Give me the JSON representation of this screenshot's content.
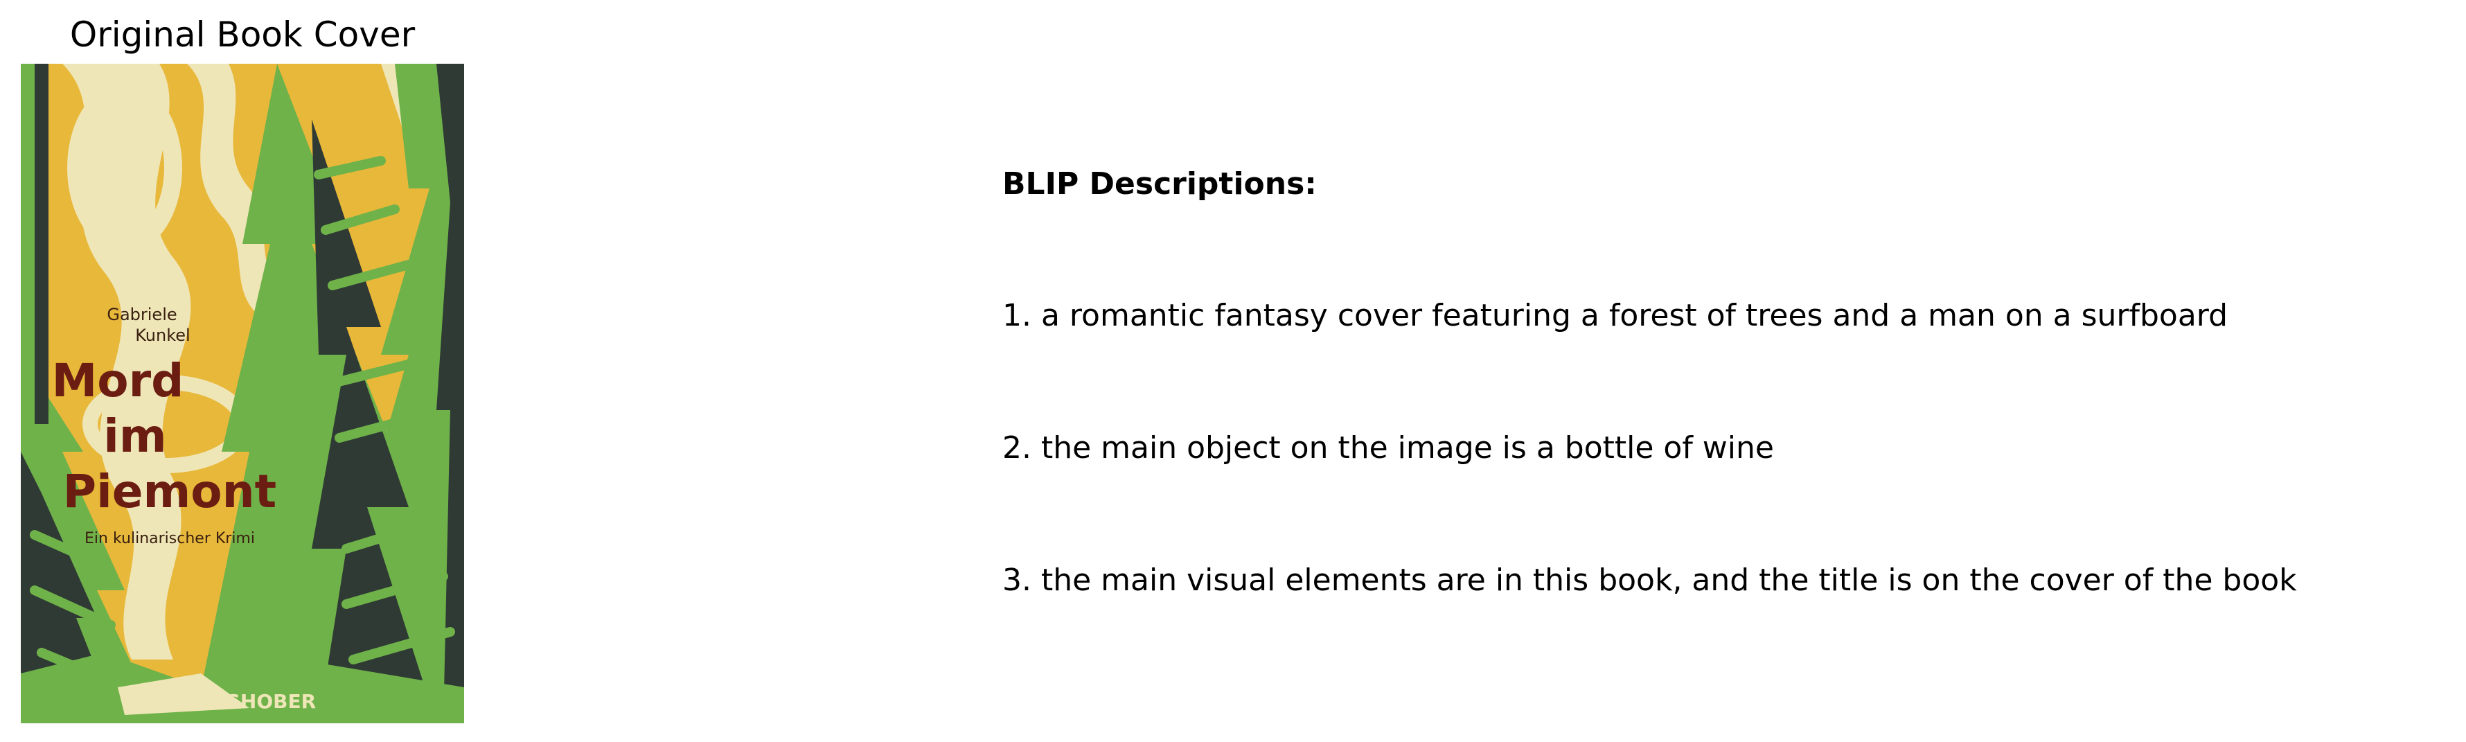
{
  "cover_panel": {
    "heading": "Original Book Cover",
    "book": {
      "author_first": "Gabriele",
      "author_last": "Kunkel",
      "title_line1": "Mord",
      "title_line2": "im",
      "title_line3": "Piemont",
      "subtitle": "Ein kulinarischer Krimi",
      "publisher": "TOSHOBER",
      "spine_text": "Ein kulinarischer Krimi"
    },
    "colors": {
      "yellow": "#e8b83a",
      "cream": "#efe6b8",
      "green": "#6fb24a",
      "dark": "#2f3a34",
      "title_red": "#6b1d12"
    }
  },
  "descriptions": {
    "header": "BLIP Descriptions:",
    "items": [
      "1. a romantic fantasy cover featuring a forest of trees and a man on a surfboard",
      "2. the main object on the image is a bottle of wine",
      "3. the main visual elements are in this book, and the title is on the cover of the book"
    ]
  }
}
